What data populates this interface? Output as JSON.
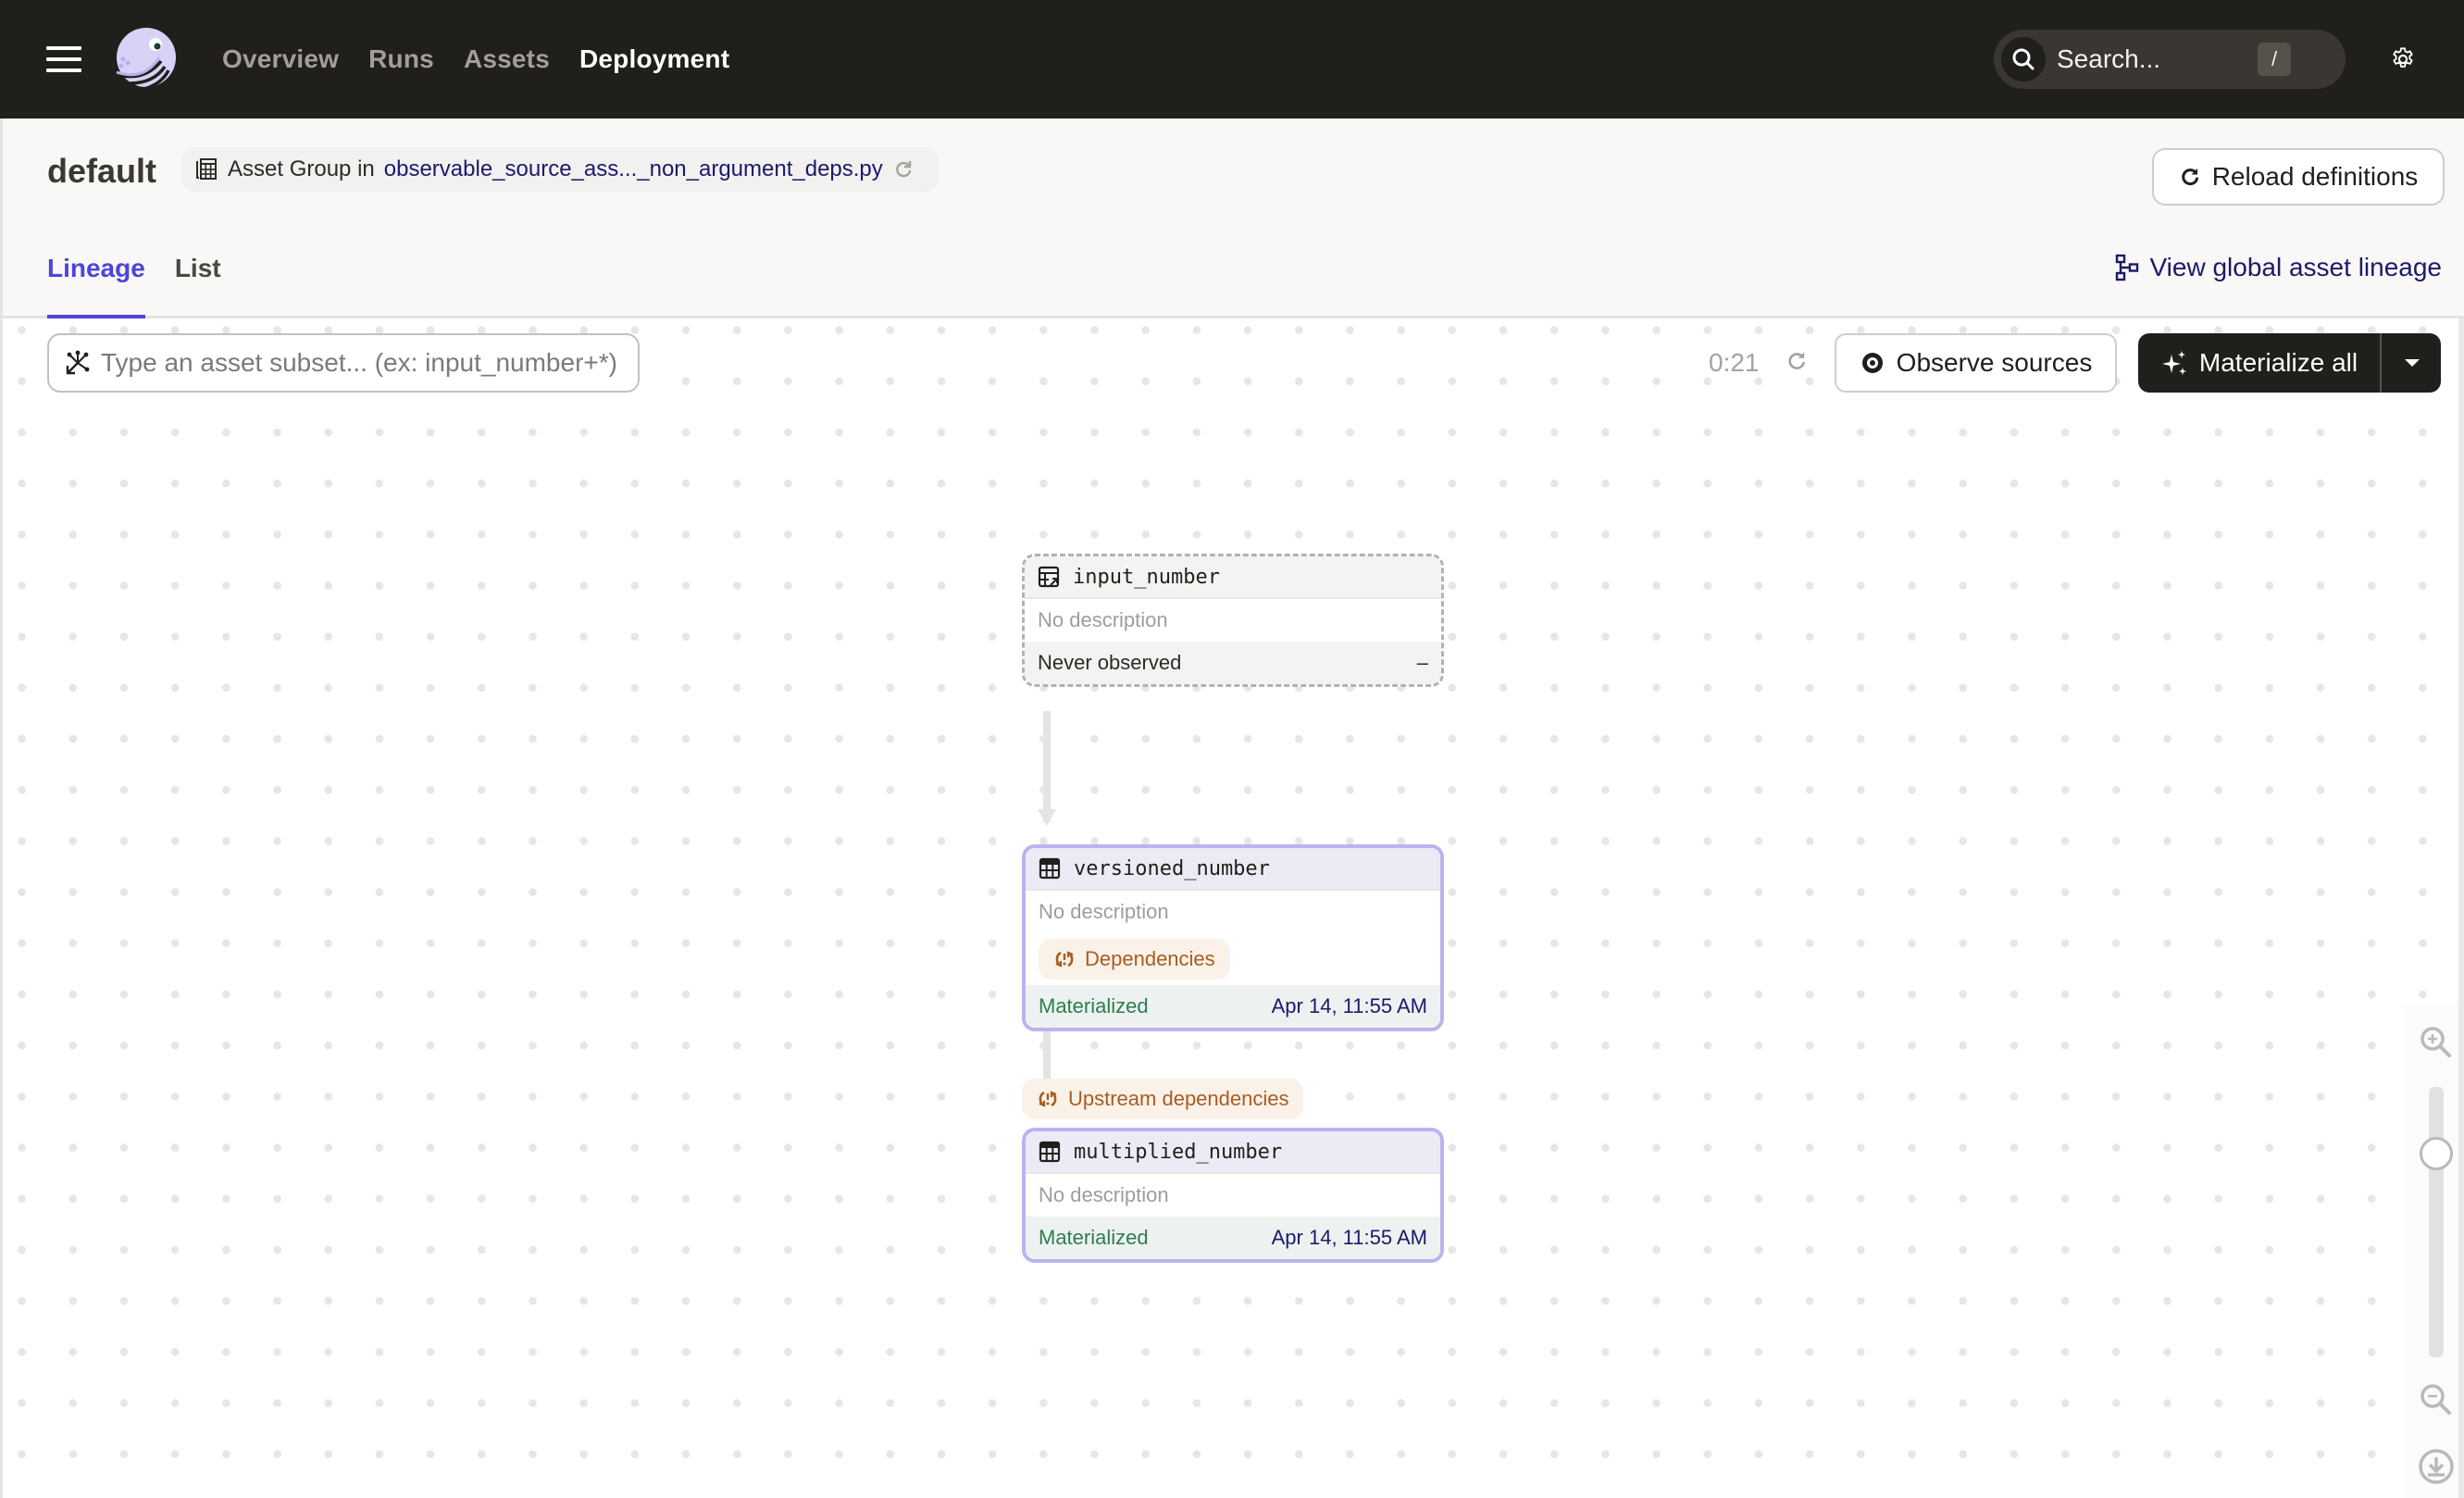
{
  "topnav": {
    "links": [
      {
        "label": "Overview",
        "active": false
      },
      {
        "label": "Runs",
        "active": false
      },
      {
        "label": "Assets",
        "active": false
      },
      {
        "label": "Deployment",
        "active": true
      }
    ],
    "search_placeholder": "Search...",
    "search_shortcut": "/"
  },
  "header": {
    "title": "default",
    "group_prefix": "Asset Group in",
    "group_location": "observable_source_ass..._non_argument_deps.py",
    "reload_label": "Reload definitions",
    "tabs": [
      {
        "label": "Lineage",
        "active": true
      },
      {
        "label": "List",
        "active": false
      }
    ],
    "global_lineage_label": "View global asset lineage"
  },
  "toolbar": {
    "filter_placeholder": "Type an asset subset... (ex: input_number+*)",
    "timer": "0:21",
    "observe_label": "Observe sources",
    "materialize_label": "Materialize all"
  },
  "graph": {
    "nodes": [
      {
        "name": "input_number",
        "kind": "source",
        "description": "No description",
        "status": "Never observed",
        "time": "–"
      },
      {
        "name": "versioned_number",
        "kind": "asset",
        "description": "No description",
        "badge": "Dependencies",
        "status": "Materialized",
        "time": "Apr 14, 11:55 AM"
      },
      {
        "name": "multiplied_number",
        "kind": "asset",
        "description": "No description",
        "status": "Materialized",
        "time": "Apr 14, 11:55 AM"
      }
    ],
    "upstream_badge": "Upstream dependencies",
    "zoom_level": 0.75
  },
  "colors": {
    "accent": "#4f43dd",
    "nav_bg": "#211f1b",
    "link": "#1b1a6b",
    "success": "#2e7d4f",
    "warning": "#a75d21"
  }
}
